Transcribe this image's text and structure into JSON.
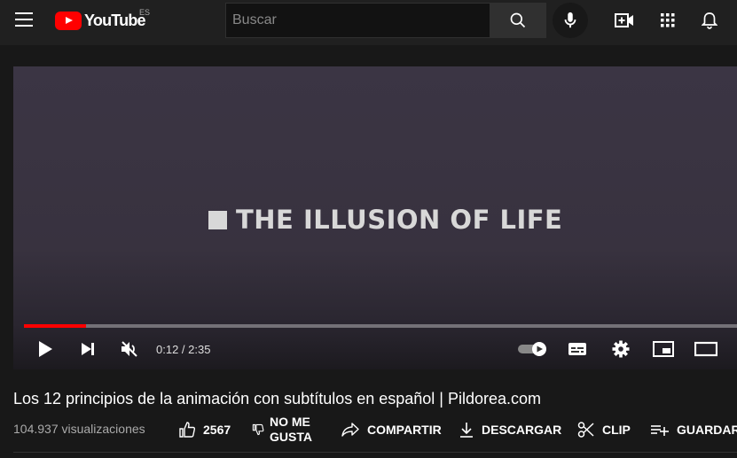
{
  "header": {
    "logo_text": "YouTube",
    "region": "ES",
    "search_placeholder": "Buscar"
  },
  "player": {
    "title_overlay": "THE ILLUSION OF LIFE",
    "current_time": "0:12",
    "separator": " / ",
    "duration": "2:35",
    "progress_fraction": 0.087,
    "accent_color": "#ff0000"
  },
  "video": {
    "title": "Los 12 principios de la animación con subtítulos en español | Pildorea.com",
    "views": "104.937 visualizaciones"
  },
  "actions": {
    "like_count": "2567",
    "dislike_line1": "NO ME",
    "dislike_line2": "GUSTA",
    "share": "COMPARTIR",
    "download": "DESCARGAR",
    "clip": "CLIP",
    "save": "GUARDAR"
  },
  "icons": [
    "menu-icon",
    "youtube-logo-icon",
    "search-icon",
    "microphone-icon",
    "create-video-icon",
    "apps-icon",
    "notifications-bell-icon",
    "play-icon",
    "next-icon",
    "muted-volume-icon",
    "autoplay-toggle-icon",
    "subtitles-icon",
    "settings-gear-icon",
    "miniplayer-icon",
    "theater-mode-icon",
    "thumbs-up-icon",
    "thumbs-down-icon",
    "share-arrow-icon",
    "download-icon",
    "scissors-icon",
    "add-to-playlist-icon"
  ]
}
